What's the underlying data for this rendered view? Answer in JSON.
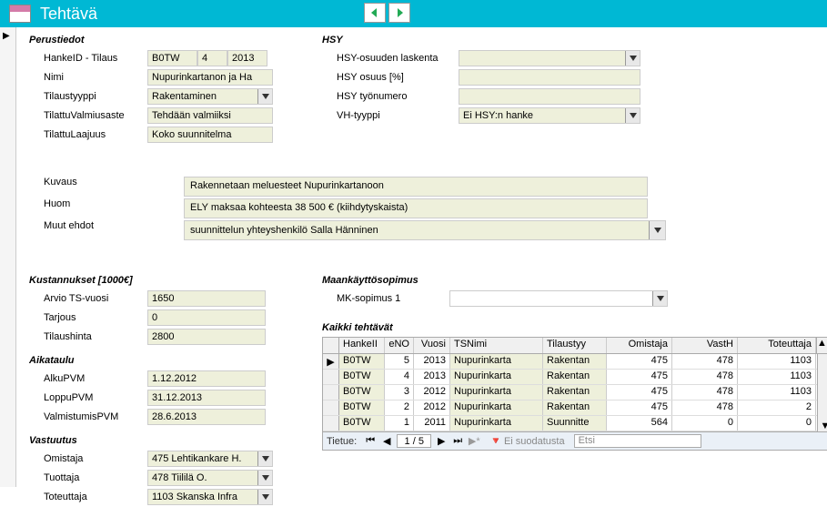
{
  "header": {
    "title": "Tehtävä"
  },
  "sections": {
    "perustiedot": "Perustiedot",
    "hsy": "HSY",
    "kustannukset": "Kustannukset [1000€]",
    "aikataulu": "Aikataulu",
    "vastuutus": "Vastuutus",
    "maankaytto": "Maankäyttösopimus",
    "kaikki": "Kaikki tehtävät"
  },
  "labels": {
    "hankeid": "HankeID - Tilaus",
    "nimi": "Nimi",
    "tilaustyyppi": "Tilaustyyppi",
    "valmiusaste": "TilattuValmiusaste",
    "laajuus": "TilattuLaajuus",
    "kuvaus": "Kuvaus",
    "huom": "Huom",
    "muut": "Muut ehdot",
    "hsy_laskenta": "HSY-osuuden laskenta",
    "hsy_osuus": "HSY osuus [%]",
    "hsy_tyonro": "HSY työnumero",
    "vh_tyyppi": "VH-tyyppi",
    "mk1": "MK-sopimus 1",
    "arvio": "Arvio TS-vuosi",
    "tarjous": "Tarjous",
    "tilaushinta": "Tilaushinta",
    "alku": "AlkuPVM",
    "loppu": "LoppuPVM",
    "valmis": "ValmistumisPVM",
    "omistaja": "Omistaja",
    "tuottaja": "Tuottaja",
    "toteuttaja": "Toteuttaja"
  },
  "values": {
    "hankeid": "B0TW",
    "eno": "4",
    "vuosi": "2013",
    "nimi": "Nupurinkartanon ja Ha",
    "tilaustyyppi": "Rakentaminen",
    "valmiusaste": "Tehdään valmiiksi",
    "laajuus": "Koko suunnitelma",
    "kuvaus": "Rakennetaan meluesteet Nupurinkartanoon",
    "huom": "ELY maksaa kohteesta 38 500 € (kiihdytyskaista)",
    "muut": "suunnittelun yhteyshenkilö Salla Hänninen",
    "vh_tyyppi": "Ei HSY:n hanke",
    "arvio": "1650",
    "tarjous": "0",
    "tilaushinta": "2800",
    "alku": "1.12.2012",
    "loppu": "31.12.2013",
    "valmis": "28.6.2013",
    "omistaja": "475 Lehtikankare H.",
    "tuottaja": "478 Tiililä O.",
    "toteuttaja": "1103 Skanska Infra"
  },
  "table": {
    "headers": {
      "hankeid": "HankeII",
      "eno": "eNO",
      "vuosi": "Vuosi",
      "tsnimi": "TSNimi",
      "tyyppi": "Tilaustyy",
      "omistaja": "Omistaja",
      "vasth": "VastH",
      "toteuttaja": "Toteuttaja"
    },
    "rows": [
      {
        "hid": "B0TW",
        "eno": "5",
        "vuosi": "2013",
        "nimi": "Nupurinkarta",
        "tyyp": "Rakentan",
        "om": "475",
        "vh": "478",
        "tot": "1103"
      },
      {
        "hid": "B0TW",
        "eno": "4",
        "vuosi": "2013",
        "nimi": "Nupurinkarta",
        "tyyp": "Rakentan",
        "om": "475",
        "vh": "478",
        "tot": "1103"
      },
      {
        "hid": "B0TW",
        "eno": "3",
        "vuosi": "2012",
        "nimi": "Nupurinkarta",
        "tyyp": "Rakentan",
        "om": "475",
        "vh": "478",
        "tot": "1103"
      },
      {
        "hid": "B0TW",
        "eno": "2",
        "vuosi": "2012",
        "nimi": "Nupurinkarta",
        "tyyp": "Rakentan",
        "om": "475",
        "vh": "478",
        "tot": "2"
      },
      {
        "hid": "B0TW",
        "eno": "1",
        "vuosi": "2011",
        "nimi": "Nupurinkarta",
        "tyyp": "Suunnitte",
        "om": "564",
        "vh": "0",
        "tot": "0"
      }
    ]
  },
  "recnav": {
    "label": "Tietue:",
    "pos": "1 / 5",
    "filter": "Ei suodatusta",
    "search": "Etsi"
  }
}
